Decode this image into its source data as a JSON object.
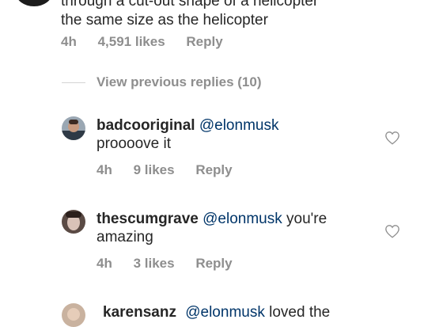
{
  "top_comment": {
    "text_line1": "through a cut-out shape of a helicopter",
    "text_line2": "the same size as the helicopter",
    "time": "4h",
    "likes": "4,591 likes",
    "reply": "Reply"
  },
  "view_previous": "View previous replies (10)",
  "replies": [
    {
      "username": "badcooriginal",
      "mention": "@elonmusk",
      "text_after_mention": "",
      "text_line2": "proooove it",
      "time": "4h",
      "likes": "9 likes",
      "reply": "Reply"
    },
    {
      "username": "thescumgrave",
      "mention": "@elonmusk",
      "text_after_mention": "you're",
      "text_line2": "amazing",
      "time": "4h",
      "likes": "3 likes",
      "reply": "Reply"
    },
    {
      "username": "karensanz",
      "mention": "@elonmusk",
      "text_after_mention": "loved the"
    }
  ],
  "icons": {
    "like": "heart-outline-icon",
    "avatar": "user-avatar"
  },
  "colors": {
    "text": "#262626",
    "muted": "#8e8e8e",
    "mention": "#003569"
  }
}
